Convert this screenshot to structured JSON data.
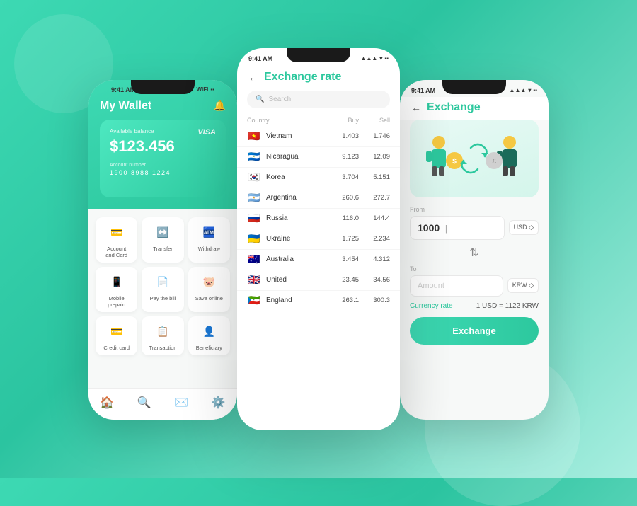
{
  "background": {
    "color1": "#3dd9b3",
    "color2": "#2bc4a0"
  },
  "phone_wallet": {
    "status_time": "9:41 AM",
    "title": "My Wallet",
    "card": {
      "balance_label": "Available balance",
      "balance": "$123.456",
      "brand": "VISA",
      "account_label": "Account number",
      "account_number": "1900 8988 1224"
    },
    "menu_items": [
      {
        "label": "Account\nand Card",
        "icon": "💳"
      },
      {
        "label": "Transfer",
        "icon": "↔️"
      },
      {
        "label": "Withdraw",
        "icon": "🏧"
      },
      {
        "label": "Mobile\nprepaid",
        "icon": "📱"
      },
      {
        "label": "Pay the bill",
        "icon": "📄"
      },
      {
        "label": "Save online",
        "icon": "🐷"
      },
      {
        "label": "Credit card",
        "icon": "💳"
      },
      {
        "label": "Transaction",
        "icon": "📋"
      },
      {
        "label": "Beneficiary",
        "icon": "👤"
      }
    ],
    "nav": [
      "🏠",
      "🔍",
      "✉️",
      "⚙️"
    ]
  },
  "phone_rates": {
    "status_time": "9:41 AM",
    "back_label": "←",
    "title": "Exchange rate",
    "search_placeholder": "Search",
    "table_headers": {
      "country": "Country",
      "buy": "Buy",
      "sell": "Sell"
    },
    "rows": [
      {
        "flag": "🇻🇳",
        "country": "Vietnam",
        "buy": "1.403",
        "sell": "1.746"
      },
      {
        "flag": "🇳🇮",
        "country": "Nicaragua",
        "buy": "9.123",
        "sell": "12.09"
      },
      {
        "flag": "🇰🇷",
        "country": "Korea",
        "buy": "3.704",
        "sell": "5.151"
      },
      {
        "flag": "🇦🇷",
        "country": "Argentina",
        "buy": "260.6",
        "sell": "272.7"
      },
      {
        "flag": "🇷🇺",
        "country": "Russia",
        "buy": "116.0",
        "sell": "144.4"
      },
      {
        "flag": "🇺🇦",
        "country": "Ukraine",
        "buy": "1.725",
        "sell": "2.234"
      },
      {
        "flag": "🇦🇺",
        "country": "Australia",
        "buy": "3.454",
        "sell": "4.312"
      },
      {
        "flag": "🇬🇧",
        "country": "United",
        "buy": "23.45",
        "sell": "34.56"
      },
      {
        "flag": "🇬🇶",
        "country": "England",
        "buy": "263.1",
        "sell": "300.3"
      }
    ]
  },
  "phone_exchange": {
    "status_time": "9:41 AM",
    "back_label": "←",
    "title": "Exchange",
    "form": {
      "from_label": "From",
      "from_value": "1000",
      "from_currency": "USD ◇",
      "to_label": "To",
      "amount_placeholder": "Amount",
      "to_currency": "KRW ◇"
    },
    "rate_label": "Currency rate",
    "rate_value": "1 USD = 1122 KRW",
    "exchange_button": "Exchange"
  }
}
